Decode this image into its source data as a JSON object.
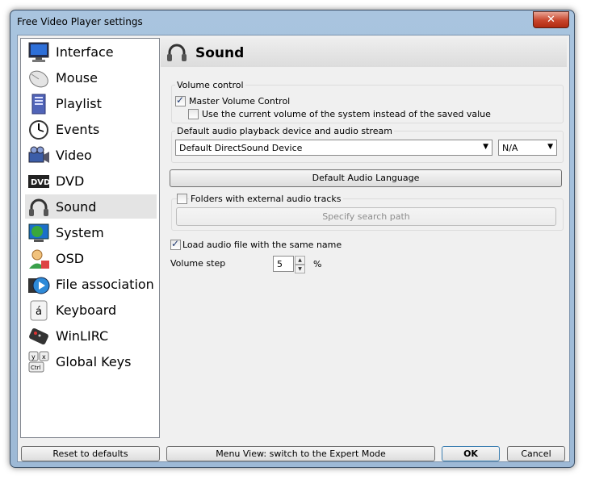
{
  "window": {
    "title": "Free Video Player settings",
    "close_glyph": "✕"
  },
  "nav": {
    "items": [
      {
        "label": "Interface",
        "icon": "monitor-icon"
      },
      {
        "label": "Mouse",
        "icon": "mouse-icon"
      },
      {
        "label": "Playlist",
        "icon": "book-icon"
      },
      {
        "label": "Events",
        "icon": "clock-icon"
      },
      {
        "label": "Video",
        "icon": "camera-icon"
      },
      {
        "label": "DVD",
        "icon": "dvd-icon"
      },
      {
        "label": "Sound",
        "icon": "headphones-icon",
        "selected": true
      },
      {
        "label": "System",
        "icon": "globe-icon"
      },
      {
        "label": "OSD",
        "icon": "user-icon"
      },
      {
        "label": "File association",
        "icon": "media-icon"
      },
      {
        "label": "Keyboard",
        "icon": "key-icon"
      },
      {
        "label": "WinLIRC",
        "icon": "remote-icon"
      },
      {
        "label": "Global Keys",
        "icon": "keys-icon"
      }
    ]
  },
  "panel": {
    "title": "Sound"
  },
  "volume_control": {
    "group_label": "Volume control",
    "master_label": "Master Volume Control",
    "master_checked": true,
    "system_label": "Use the current volume of the system instead of the saved value",
    "system_checked": false
  },
  "playback": {
    "group_label": "Default audio playback device and audio stream",
    "device": "Default DirectSound Device",
    "stream": "N/A"
  },
  "language_button": "Default Audio Language",
  "folders": {
    "label": "Folders with external audio tracks",
    "checked": false,
    "search_button": "Specify search path"
  },
  "load_audio": {
    "label": "Load audio file with the same name",
    "checked": true
  },
  "volume_step": {
    "label": "Volume step",
    "value": "5",
    "unit": "%"
  },
  "footer": {
    "reset": "Reset to defaults",
    "menu_view": "Menu View: switch to the Expert Mode",
    "ok": "OK",
    "cancel": "Cancel"
  }
}
